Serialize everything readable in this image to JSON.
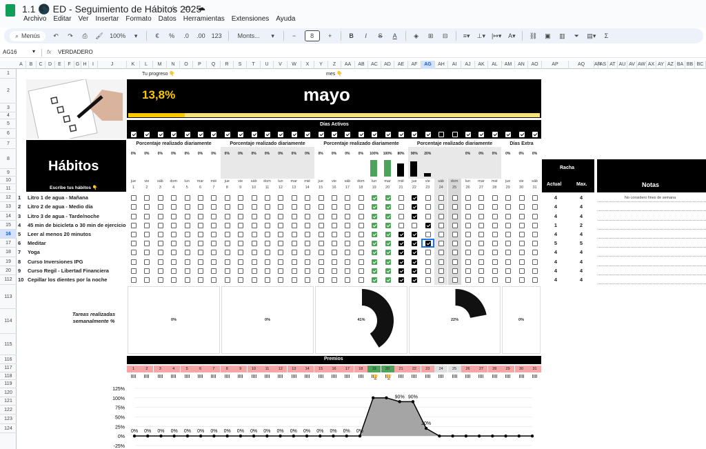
{
  "doc": {
    "title": "1.1 🌑 ED - Seguimiento de Hábitos 2025"
  },
  "menu": [
    "Archivo",
    "Editar",
    "Ver",
    "Insertar",
    "Formato",
    "Datos",
    "Herramientas",
    "Extensiones",
    "Ayuda"
  ],
  "toolbar": {
    "search_label": "Menús",
    "zoom": "100%",
    "currency": "€",
    "percent": "%",
    "dec_dec": ".0",
    "dec_inc": ".00",
    "num_format": "123",
    "font": "Monts...",
    "font_size": "8",
    "bold": "B",
    "italic": "I",
    "strike": "S",
    "textcolor": "A"
  },
  "formula": {
    "cell_ref": "AG16",
    "fx": "fx",
    "value": "VERDADERO"
  },
  "columns": [
    "A",
    "B",
    "C",
    "D",
    "E",
    "F",
    "G",
    "H",
    "I",
    "J",
    "K",
    "L",
    "M",
    "N",
    "O",
    "P",
    "Q",
    "R",
    "S",
    "T",
    "U",
    "V",
    "W",
    "X",
    "Y",
    "Z",
    "AA",
    "AB",
    "AC",
    "AD",
    "AE",
    "AF",
    "AG",
    "AH",
    "AI",
    "AJ",
    "AK",
    "AL",
    "AM",
    "AN",
    "AO",
    "AP",
    "AQ",
    "AR",
    "AS",
    "AT",
    "AU",
    "AV",
    "AW",
    "AX",
    "AY",
    "AZ",
    "BA",
    "BB",
    "BC"
  ],
  "rows": [
    "1",
    "2",
    "3",
    "4",
    "5",
    "6",
    "7",
    "8",
    "9",
    "10",
    "11",
    "12",
    "13",
    "14",
    "15",
    "16",
    "17",
    "18",
    "19",
    "20",
    "112",
    "113",
    "114",
    "115",
    "116",
    "117",
    "118",
    "119",
    "120",
    "121",
    "122",
    "123",
    "124"
  ],
  "header": {
    "tu_progreso": "Tu progreso 👇",
    "mes_label": "mes 👇",
    "progress_value": "13,8%",
    "progress_fraction": 0.138,
    "month": "mayo",
    "dias_activos": "Días Activos",
    "habitos": "Hábitos",
    "escribe": "Escribe tus hábitos 👇",
    "pct_diario": "Porcentaje realizado diariamente",
    "dias_extra": "Días Extra",
    "racha": "Racha",
    "actual": "Actual",
    "max": "Max.",
    "notas": "Notas",
    "nota1": "No considero fines de semana"
  },
  "days": [
    {
      "d": "jue",
      "n": "1",
      "pct": "0%"
    },
    {
      "d": "vie",
      "n": "2",
      "pct": "0%"
    },
    {
      "d": "sáb",
      "n": "3",
      "pct": "0%"
    },
    {
      "d": "dom",
      "n": "4",
      "pct": "0%"
    },
    {
      "d": "lun",
      "n": "5",
      "pct": "0%"
    },
    {
      "d": "mar",
      "n": "6",
      "pct": "0%"
    },
    {
      "d": "mié",
      "n": "7",
      "pct": "0%"
    },
    {
      "d": "jue",
      "n": "8",
      "pct": "0%"
    },
    {
      "d": "vie",
      "n": "9",
      "pct": "0%"
    },
    {
      "d": "sáb",
      "n": "10",
      "pct": "0%"
    },
    {
      "d": "dom",
      "n": "11",
      "pct": "0%"
    },
    {
      "d": "lun",
      "n": "12",
      "pct": "0%"
    },
    {
      "d": "mar",
      "n": "13",
      "pct": "0%"
    },
    {
      "d": "mié",
      "n": "14",
      "pct": "0%"
    },
    {
      "d": "jue",
      "n": "15",
      "pct": "0%"
    },
    {
      "d": "vie",
      "n": "16",
      "pct": "0%"
    },
    {
      "d": "sáb",
      "n": "17",
      "pct": "0%"
    },
    {
      "d": "dom",
      "n": "18",
      "pct": "0%"
    },
    {
      "d": "lun",
      "n": "19",
      "pct": "100%"
    },
    {
      "d": "mar",
      "n": "20",
      "pct": "100%"
    },
    {
      "d": "mié",
      "n": "21",
      "pct": "80%"
    },
    {
      "d": "jue",
      "n": "22",
      "pct": "90%"
    },
    {
      "d": "vie",
      "n": "23",
      "pct": "20%"
    },
    {
      "d": "sáb",
      "n": "24",
      "pct": ""
    },
    {
      "d": "dom",
      "n": "25",
      "pct": ""
    },
    {
      "d": "lun",
      "n": "26",
      "pct": "0%"
    },
    {
      "d": "mar",
      "n": "27",
      "pct": "0%"
    },
    {
      "d": "mié",
      "n": "28",
      "pct": "0%"
    },
    {
      "d": "jue",
      "n": "29",
      "pct": "0%"
    },
    {
      "d": "vie",
      "n": "30",
      "pct": "0%"
    },
    {
      "d": "sáb",
      "n": "31",
      "pct": "0%"
    }
  ],
  "habits": [
    {
      "no": "1",
      "name": "Litro 1 de agua - Mañana",
      "actual": "4",
      "max": "4"
    },
    {
      "no": "2",
      "name": "Litro 2 de agua - Medio día",
      "actual": "4",
      "max": "4"
    },
    {
      "no": "3",
      "name": "Litro 3 de agua - Tarde/noche",
      "actual": "4",
      "max": "4"
    },
    {
      "no": "4",
      "name": "45 min de bicicleta o 30 min de ejercicio",
      "actual": "1",
      "max": "2"
    },
    {
      "no": "5",
      "name": "Leer al menos 20 minutos",
      "actual": "4",
      "max": "4"
    },
    {
      "no": "6",
      "name": "Meditar",
      "actual": "5",
      "max": "5"
    },
    {
      "no": "7",
      "name": "Yoga",
      "actual": "4",
      "max": "4"
    },
    {
      "no": "8",
      "name": "Curso Inversiones IPG",
      "actual": "4",
      "max": "4"
    },
    {
      "no": "9",
      "name": "Curso Regil - Libertad Financiera",
      "actual": "4",
      "max": "4"
    },
    {
      "no": "10",
      "name": "Cepillar los dientes por la noche",
      "actual": "4",
      "max": "4"
    }
  ],
  "weekly": {
    "label": "Tareas realizadas semanalmente %",
    "values": [
      "0%",
      "0%",
      "41%",
      "22%",
      "0%"
    ],
    "fractions": [
      0,
      0,
      0.41,
      0.22,
      0
    ]
  },
  "premios": {
    "title": "Premios",
    "numbers": [
      "1",
      "2",
      "3",
      "4",
      "5",
      "6",
      "7",
      "8",
      "9",
      "10",
      "11",
      "12",
      "13",
      "14",
      "15",
      "16",
      "17",
      "18",
      "19",
      "20",
      "21",
      "22",
      "23",
      "24",
      "25",
      "26",
      "27",
      "28",
      "29",
      "30",
      "31"
    ]
  },
  "chart_data": {
    "type": "area",
    "x": [
      "1",
      "2",
      "3",
      "4",
      "5",
      "6",
      "7",
      "8",
      "9",
      "10",
      "11",
      "12",
      "13",
      "14",
      "15",
      "16",
      "17",
      "18",
      "19",
      "20",
      "21",
      "22",
      "23",
      "24",
      "25",
      "26",
      "27",
      "28",
      "29",
      "30",
      "31"
    ],
    "values": [
      0,
      0,
      0,
      0,
      0,
      0,
      0,
      0,
      0,
      0,
      0,
      0,
      0,
      0,
      0,
      0,
      0,
      0,
      100,
      100,
      90,
      90,
      20,
      0,
      0,
      0,
      0,
      0,
      0,
      0,
      0
    ],
    "labels": [
      "0%",
      "0%",
      "0%",
      "0%",
      "0%",
      "0%",
      "0%",
      "0%",
      "0%",
      "0%",
      "0%",
      "0%",
      "0%",
      "0%",
      "0%",
      "0%",
      "0%",
      "0%",
      "",
      "",
      "90%",
      "90%",
      "20%",
      "",
      "",
      "",
      "",
      "",
      "",
      "",
      ""
    ],
    "yticks": [
      "125%",
      "100%",
      "75%",
      "50%",
      "25%",
      "0%",
      "-25%"
    ],
    "ylim": [
      -25,
      125
    ]
  },
  "colors": {
    "accent_yellow": "#f9c800",
    "green": "#4ea35a",
    "pink": "#f4a6a6",
    "black": "#000000"
  }
}
